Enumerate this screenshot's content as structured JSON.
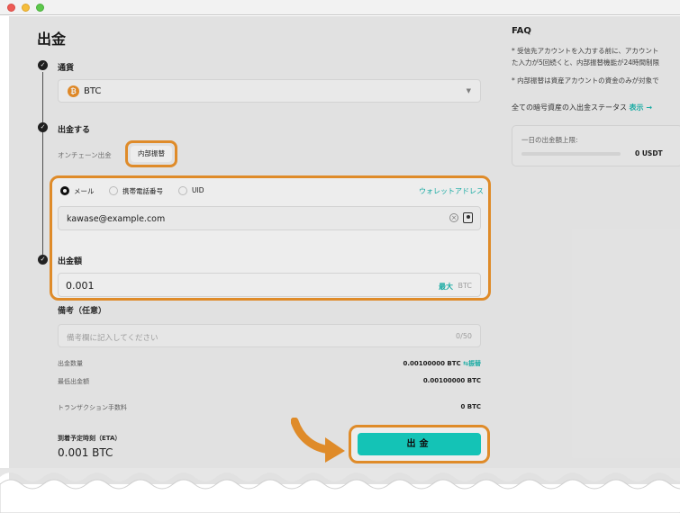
{
  "page": {
    "title": "出金"
  },
  "steps": {
    "currency": {
      "label": "通貨",
      "selected": "BTC",
      "coin_icon": "bitcoin-icon"
    },
    "withdraw": {
      "label": "出金する",
      "tabs": [
        {
          "label": "オンチェーン出金",
          "active": false
        },
        {
          "label": "内部振替",
          "active": true
        }
      ],
      "recipient_options": [
        {
          "label": "メール",
          "selected": true
        },
        {
          "label": "携帯電話番号",
          "selected": false
        },
        {
          "label": "UID",
          "selected": false
        }
      ],
      "wallet_address_link": "ウォレットアドレス",
      "email_value": "kawase@example.com"
    },
    "amount": {
      "label": "出金額",
      "value": "0.001",
      "max_label": "最大",
      "unit": "BTC"
    }
  },
  "memo": {
    "label": "備考（任意）",
    "placeholder": "備考欄に記入してください",
    "counter": "0/50"
  },
  "summary": {
    "rows": [
      {
        "key": "出金数量",
        "value": "0.00100000 BTC",
        "extra": "⇆振替"
      },
      {
        "key": "最低出金額",
        "value": "0.00100000 BTC",
        "extra": ""
      },
      {
        "key": "トランザクション手数料",
        "value": "0 BTC",
        "extra": ""
      }
    ]
  },
  "eta": {
    "label": "到着予定時刻（ETA）",
    "value": "0.001 BTC"
  },
  "submit": {
    "label": "出金"
  },
  "faq": {
    "title": "FAQ",
    "lines": [
      "* 受信先アカウントを入力する前に、アカウント",
      "た入力が5回続くと、内部振替機能が24時間制限",
      "* 内部振替は資産アカウントの資金のみが対象で"
    ],
    "status_text": "全ての暗号資産の入出金ステータス",
    "status_link": "表示 →",
    "daily_limit_label": "一日の出金額上限:",
    "daily_limit_value": "0 USDT"
  },
  "colors": {
    "accent_teal": "#16d2c4",
    "highlight_orange": "#f0962d"
  }
}
